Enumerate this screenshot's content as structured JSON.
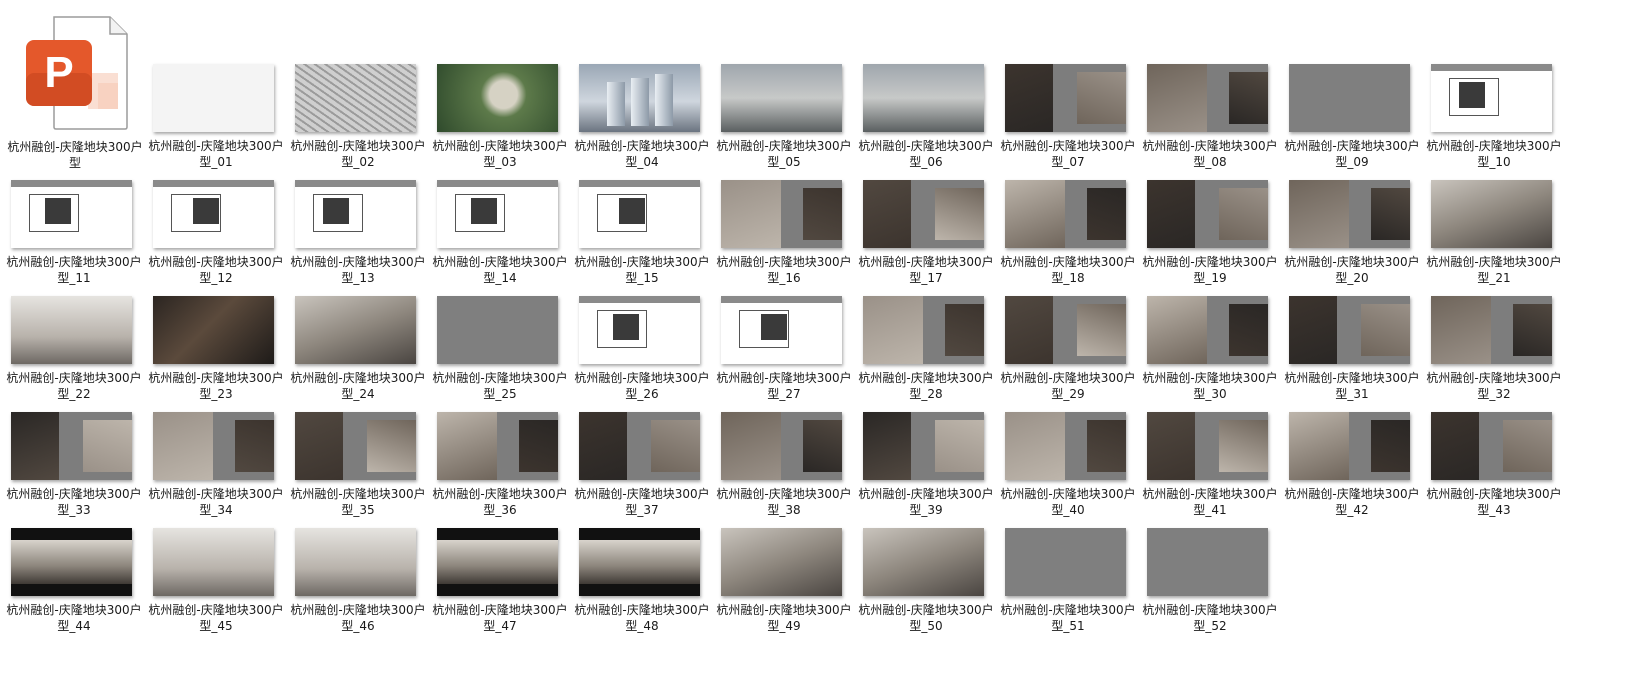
{
  "file": {
    "name": "杭州融创-庆隆地块300户型",
    "icon": "powerpoint-file-icon",
    "icon_color": "#e4582b"
  },
  "slides": [
    {
      "label": "杭州融创-庆隆地块300户型_01",
      "style": "white"
    },
    {
      "label": "杭州融创-庆隆地块300户型_02",
      "style": "map"
    },
    {
      "label": "杭州融创-庆隆地块300户型_03",
      "style": "aerial"
    },
    {
      "label": "杭州融创-庆隆地块300户型_04",
      "style": "city"
    },
    {
      "label": "杭州融创-庆隆地块300户型_05",
      "style": "sky"
    },
    {
      "label": "杭州融创-庆隆地块300户型_06",
      "style": "sky"
    },
    {
      "label": "杭州融创-庆隆地块300户型_07",
      "style": "split"
    },
    {
      "label": "杭州融创-庆隆地块300户型_08",
      "style": "split"
    },
    {
      "label": "杭州融创-庆隆地块300户型_09",
      "style": "gray"
    },
    {
      "label": "杭州融创-庆隆地块300户型_10",
      "style": "plan"
    },
    {
      "label": "杭州融创-庆隆地块300户型_11",
      "style": "plan"
    },
    {
      "label": "杭州融创-庆隆地块300户型_12",
      "style": "plan"
    },
    {
      "label": "杭州融创-庆隆地块300户型_13",
      "style": "plan"
    },
    {
      "label": "杭州融创-庆隆地块300户型_14",
      "style": "plan"
    },
    {
      "label": "杭州融创-庆隆地块300户型_15",
      "style": "plan"
    },
    {
      "label": "杭州融创-庆隆地块300户型_16",
      "style": "split"
    },
    {
      "label": "杭州融创-庆隆地块300户型_17",
      "style": "split"
    },
    {
      "label": "杭州融创-庆隆地块300户型_18",
      "style": "split"
    },
    {
      "label": "杭州融创-庆隆地块300户型_19",
      "style": "split"
    },
    {
      "label": "杭州融创-庆隆地块300户型_20",
      "style": "split"
    },
    {
      "label": "杭州融创-庆隆地块300户型_21",
      "style": "room"
    },
    {
      "label": "杭州融创-庆隆地块300户型_22",
      "style": "bright"
    },
    {
      "label": "杭州融创-庆隆地块300户型_23",
      "style": "dark"
    },
    {
      "label": "杭州融创-庆隆地块300户型_24",
      "style": "room"
    },
    {
      "label": "杭州融创-庆隆地块300户型_25",
      "style": "gray"
    },
    {
      "label": "杭州融创-庆隆地块300户型_26",
      "style": "plan"
    },
    {
      "label": "杭州融创-庆隆地块300户型_27",
      "style": "plan"
    },
    {
      "label": "杭州融创-庆隆地块300户型_28",
      "style": "split"
    },
    {
      "label": "杭州融创-庆隆地块300户型_29",
      "style": "split"
    },
    {
      "label": "杭州融创-庆隆地块300户型_30",
      "style": "split"
    },
    {
      "label": "杭州融创-庆隆地块300户型_31",
      "style": "split"
    },
    {
      "label": "杭州融创-庆隆地块300户型_32",
      "style": "split"
    },
    {
      "label": "杭州融创-庆隆地块300户型_33",
      "style": "split"
    },
    {
      "label": "杭州融创-庆隆地块300户型_34",
      "style": "split"
    },
    {
      "label": "杭州融创-庆隆地块300户型_35",
      "style": "split"
    },
    {
      "label": "杭州融创-庆隆地块300户型_36",
      "style": "split"
    },
    {
      "label": "杭州融创-庆隆地块300户型_37",
      "style": "split"
    },
    {
      "label": "杭州融创-庆隆地块300户型_38",
      "style": "split"
    },
    {
      "label": "杭州融创-庆隆地块300户型_39",
      "style": "split"
    },
    {
      "label": "杭州融创-庆隆地块300户型_40",
      "style": "split"
    },
    {
      "label": "杭州融创-庆隆地块300户型_41",
      "style": "split"
    },
    {
      "label": "杭州融创-庆隆地块300户型_42",
      "style": "split"
    },
    {
      "label": "杭州融创-庆隆地块300户型_43",
      "style": "split"
    },
    {
      "label": "杭州融创-庆隆地块300户型_44",
      "style": "black"
    },
    {
      "label": "杭州融创-庆隆地块300户型_45",
      "style": "bright"
    },
    {
      "label": "杭州融创-庆隆地块300户型_46",
      "style": "bright"
    },
    {
      "label": "杭州融创-庆隆地块300户型_47",
      "style": "black"
    },
    {
      "label": "杭州融创-庆隆地块300户型_48",
      "style": "black"
    },
    {
      "label": "杭州融创-庆隆地块300户型_49",
      "style": "room"
    },
    {
      "label": "杭州融创-庆隆地块300户型_50",
      "style": "room"
    },
    {
      "label": "杭州融创-庆隆地块300户型_51",
      "style": "gray"
    },
    {
      "label": "杭州融创-庆隆地块300户型_52",
      "style": "gray"
    }
  ]
}
